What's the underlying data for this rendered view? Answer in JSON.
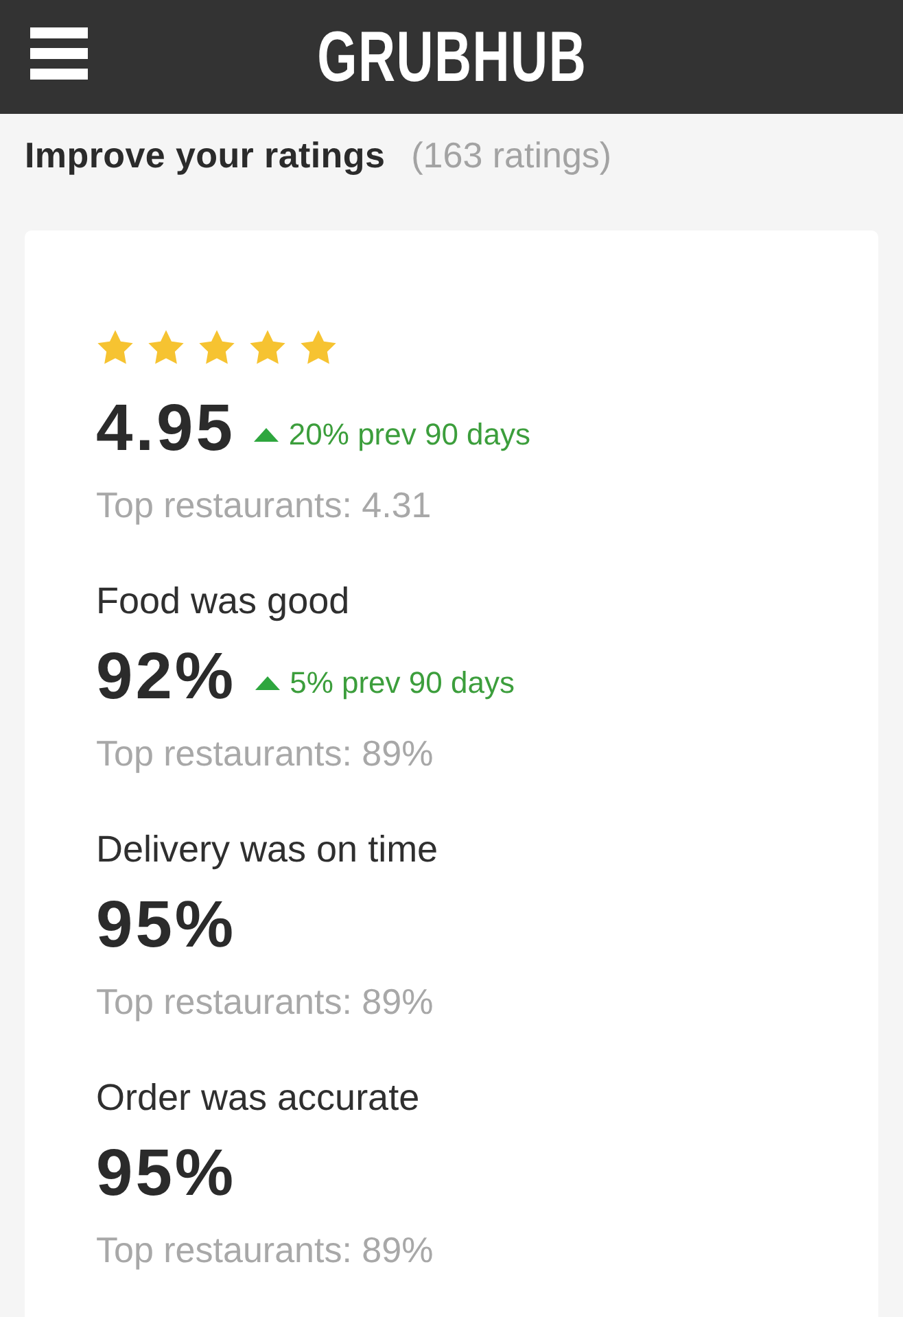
{
  "header": {
    "logo": "GRUBHUB"
  },
  "page": {
    "title": "Improve your ratings",
    "count": "(163 ratings)"
  },
  "metrics": [
    {
      "kind": "stars",
      "stars": 5,
      "value": "4.95",
      "trend": {
        "up": true,
        "text": "20% prev 90 days"
      },
      "benchmark": "Top restaurants: 4.31"
    },
    {
      "kind": "label",
      "label": "Food was good",
      "value": "92%",
      "trend": {
        "up": true,
        "text": "5% prev 90 days"
      },
      "benchmark": "Top restaurants: 89%"
    },
    {
      "kind": "label",
      "label": "Delivery was on time",
      "value": "95%",
      "benchmark": "Top restaurants: 89%"
    },
    {
      "kind": "label",
      "label": "Order was accurate",
      "value": "95%",
      "benchmark": "Top restaurants: 89%"
    }
  ]
}
